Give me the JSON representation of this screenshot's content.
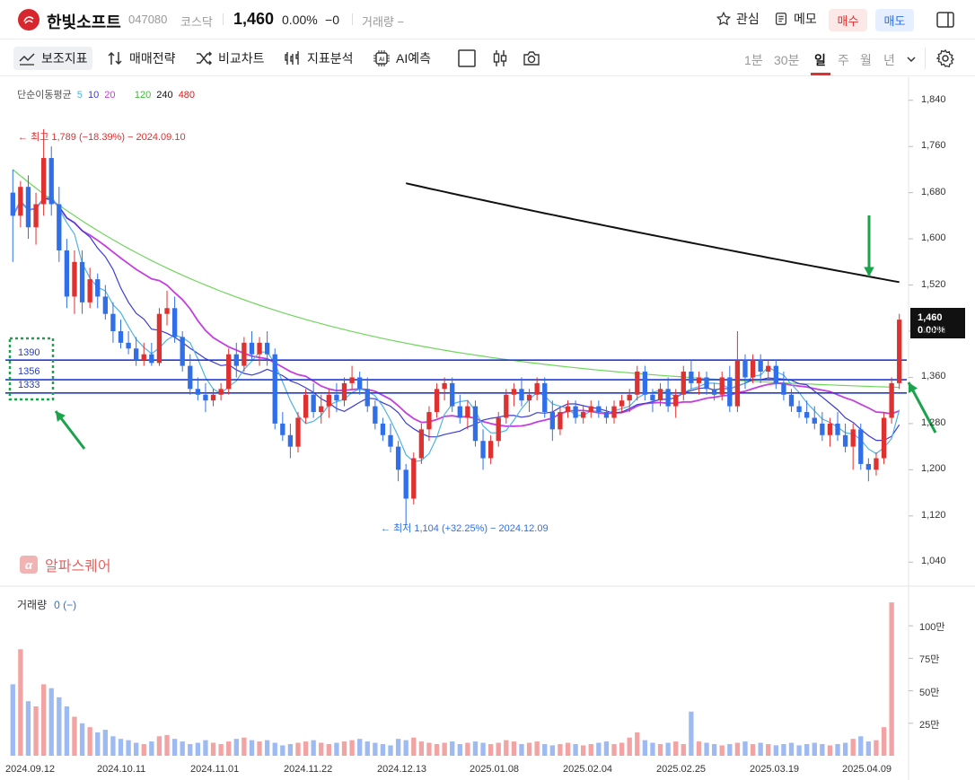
{
  "header": {
    "stock_name": "한빛소프트",
    "stock_code": "047080",
    "market": "코스닥",
    "price": "1,460",
    "change_pct": "0.00%",
    "change_abs": "0",
    "change_abs_symbol": "−",
    "volume_label": "거래량 −",
    "favorite_label": "관심",
    "memo_label": "메모",
    "buy_label": "매수",
    "sell_label": "매도"
  },
  "toolbar": {
    "indicator_label": "보조지표",
    "strategy_label": "매매전략",
    "compare_label": "비교차트",
    "analysis_label": "지표분석",
    "ai_label": "AI예측",
    "periods": [
      "1분",
      "30분",
      "일",
      "주",
      "월",
      "년"
    ],
    "active_period": "일"
  },
  "colors": {
    "up": "#e03131",
    "down": "#2f6fea",
    "ma5": "#4fb3e6",
    "ma10": "#3b3bd6",
    "ma20": "#c43ee0",
    "ma120": "#6fd65c",
    "ma240": "#111111",
    "ma480": "#d81b1b",
    "support_line": "#1f3bd9",
    "annotation_arrow": "#1aa34a",
    "box_border": "#1aa34a"
  },
  "chart_data": {
    "type": "candlestick",
    "title": "",
    "legend_title": "단순이동평균",
    "legend_items": [
      "5",
      "10",
      "20",
      "120",
      "240",
      "480"
    ],
    "y_axis_ticks": [
      "1,840",
      "1,760",
      "1,680",
      "1,600",
      "1,520",
      "1,440",
      "1,360",
      "1,280",
      "1,200",
      "1,120",
      "1,040"
    ],
    "y_min": 1000,
    "y_max": 1880,
    "x_date_labels": [
      "2024.09.12",
      "2024.10.11",
      "2024.11.01",
      "2024.11.22",
      "2024.12.13",
      "2025.01.08",
      "2025.02.04",
      "2025.02.25",
      "2025.03.19",
      "2025.04.09"
    ],
    "last_price_tag": "1,460",
    "last_change_tag": "0.00%",
    "high_annotation": "최고 1,789 (−18.39%) − 2024.09.10",
    "low_annotation": "최저 1,104 (+32.25%) − 2024.12.09",
    "support_lines": [
      1390,
      1356,
      1333
    ],
    "support_labels": [
      "1390",
      "1356",
      "1333"
    ],
    "candles": [
      [
        1680,
        1720,
        1560,
        1640
      ],
      [
        1640,
        1700,
        1620,
        1690
      ],
      [
        1690,
        1710,
        1600,
        1620
      ],
      [
        1620,
        1680,
        1590,
        1660
      ],
      [
        1660,
        1790,
        1640,
        1740
      ],
      [
        1740,
        1760,
        1640,
        1660
      ],
      [
        1660,
        1690,
        1560,
        1580
      ],
      [
        1580,
        1600,
        1480,
        1500
      ],
      [
        1500,
        1580,
        1470,
        1560
      ],
      [
        1560,
        1580,
        1470,
        1490
      ],
      [
        1490,
        1550,
        1480,
        1530
      ],
      [
        1530,
        1540,
        1480,
        1500
      ],
      [
        1500,
        1520,
        1460,
        1470
      ],
      [
        1470,
        1490,
        1420,
        1440
      ],
      [
        1440,
        1460,
        1410,
        1420
      ],
      [
        1420,
        1440,
        1400,
        1410
      ],
      [
        1410,
        1430,
        1380,
        1390
      ],
      [
        1390,
        1420,
        1380,
        1400
      ],
      [
        1400,
        1420,
        1380,
        1385
      ],
      [
        1385,
        1480,
        1380,
        1470
      ],
      [
        1470,
        1510,
        1450,
        1480
      ],
      [
        1480,
        1500,
        1420,
        1430
      ],
      [
        1430,
        1440,
        1370,
        1380
      ],
      [
        1380,
        1400,
        1330,
        1340
      ],
      [
        1340,
        1360,
        1320,
        1330
      ],
      [
        1330,
        1350,
        1300,
        1320
      ],
      [
        1320,
        1340,
        1310,
        1330
      ],
      [
        1330,
        1350,
        1320,
        1340
      ],
      [
        1340,
        1410,
        1330,
        1400
      ],
      [
        1400,
        1420,
        1360,
        1380
      ],
      [
        1380,
        1430,
        1370,
        1420
      ],
      [
        1420,
        1440,
        1390,
        1400
      ],
      [
        1400,
        1430,
        1380,
        1420
      ],
      [
        1420,
        1440,
        1380,
        1400
      ],
      [
        1400,
        1410,
        1270,
        1280
      ],
      [
        1280,
        1300,
        1250,
        1260
      ],
      [
        1260,
        1280,
        1220,
        1240
      ],
      [
        1240,
        1300,
        1230,
        1290
      ],
      [
        1290,
        1340,
        1280,
        1330
      ],
      [
        1330,
        1350,
        1290,
        1300
      ],
      [
        1300,
        1330,
        1280,
        1310
      ],
      [
        1310,
        1340,
        1290,
        1330
      ],
      [
        1330,
        1350,
        1300,
        1320
      ],
      [
        1320,
        1360,
        1310,
        1350
      ],
      [
        1350,
        1380,
        1340,
        1360
      ],
      [
        1360,
        1370,
        1330,
        1340
      ],
      [
        1340,
        1360,
        1300,
        1310
      ],
      [
        1310,
        1320,
        1270,
        1280
      ],
      [
        1280,
        1290,
        1250,
        1260
      ],
      [
        1260,
        1280,
        1230,
        1240
      ],
      [
        1240,
        1250,
        1180,
        1200
      ],
      [
        1200,
        1210,
        1104,
        1150
      ],
      [
        1150,
        1230,
        1140,
        1220
      ],
      [
        1220,
        1280,
        1210,
        1270
      ],
      [
        1270,
        1310,
        1250,
        1300
      ],
      [
        1300,
        1350,
        1290,
        1340
      ],
      [
        1340,
        1360,
        1320,
        1350
      ],
      [
        1350,
        1360,
        1300,
        1310
      ],
      [
        1310,
        1330,
        1280,
        1290
      ],
      [
        1290,
        1320,
        1270,
        1310
      ],
      [
        1310,
        1320,
        1240,
        1250
      ],
      [
        1250,
        1270,
        1200,
        1220
      ],
      [
        1220,
        1260,
        1210,
        1250
      ],
      [
        1250,
        1300,
        1240,
        1290
      ],
      [
        1290,
        1340,
        1280,
        1330
      ],
      [
        1330,
        1350,
        1310,
        1340
      ],
      [
        1340,
        1360,
        1310,
        1320
      ],
      [
        1320,
        1340,
        1300,
        1330
      ],
      [
        1330,
        1360,
        1320,
        1350
      ],
      [
        1350,
        1360,
        1290,
        1300
      ],
      [
        1300,
        1320,
        1250,
        1270
      ],
      [
        1270,
        1310,
        1260,
        1300
      ],
      [
        1300,
        1320,
        1290,
        1310
      ],
      [
        1310,
        1320,
        1280,
        1290
      ],
      [
        1290,
        1310,
        1280,
        1300
      ],
      [
        1300,
        1320,
        1290,
        1310
      ],
      [
        1310,
        1320,
        1290,
        1300
      ],
      [
        1300,
        1310,
        1280,
        1290
      ],
      [
        1290,
        1320,
        1280,
        1310
      ],
      [
        1310,
        1330,
        1300,
        1320
      ],
      [
        1320,
        1340,
        1300,
        1330
      ],
      [
        1330,
        1380,
        1320,
        1370
      ],
      [
        1370,
        1380,
        1320,
        1330
      ],
      [
        1330,
        1340,
        1300,
        1320
      ],
      [
        1320,
        1350,
        1310,
        1340
      ],
      [
        1340,
        1360,
        1300,
        1310
      ],
      [
        1310,
        1340,
        1290,
        1330
      ],
      [
        1330,
        1380,
        1320,
        1370
      ],
      [
        1370,
        1390,
        1340,
        1350
      ],
      [
        1350,
        1370,
        1330,
        1360
      ],
      [
        1360,
        1370,
        1330,
        1340
      ],
      [
        1340,
        1350,
        1320,
        1330
      ],
      [
        1330,
        1370,
        1320,
        1360
      ],
      [
        1360,
        1380,
        1300,
        1310
      ],
      [
        1310,
        1440,
        1300,
        1390
      ],
      [
        1390,
        1400,
        1340,
        1360
      ],
      [
        1360,
        1400,
        1350,
        1390
      ],
      [
        1390,
        1400,
        1350,
        1370
      ],
      [
        1370,
        1390,
        1360,
        1380
      ],
      [
        1380,
        1390,
        1340,
        1350
      ],
      [
        1350,
        1370,
        1320,
        1330
      ],
      [
        1330,
        1340,
        1300,
        1310
      ],
      [
        1310,
        1320,
        1290,
        1300
      ],
      [
        1300,
        1320,
        1280,
        1290
      ],
      [
        1290,
        1310,
        1270,
        1280
      ],
      [
        1280,
        1300,
        1250,
        1260
      ],
      [
        1260,
        1290,
        1240,
        1280
      ],
      [
        1280,
        1300,
        1250,
        1260
      ],
      [
        1260,
        1280,
        1230,
        1240
      ],
      [
        1240,
        1280,
        1200,
        1270
      ],
      [
        1270,
        1280,
        1200,
        1210
      ],
      [
        1210,
        1220,
        1180,
        1200
      ],
      [
        1200,
        1230,
        1190,
        1220
      ],
      [
        1220,
        1300,
        1210,
        1290
      ],
      [
        1290,
        1360,
        1280,
        1350
      ],
      [
        1350,
        1470,
        1340,
        1460
      ]
    ],
    "volumes": [
      55,
      82,
      42,
      38,
      55,
      52,
      45,
      38,
      30,
      25,
      22,
      18,
      20,
      15,
      13,
      12,
      10,
      9,
      11,
      15,
      16,
      13,
      11,
      9,
      10,
      12,
      10,
      9,
      11,
      13,
      14,
      12,
      11,
      12,
      10,
      8,
      9,
      10,
      11,
      12,
      10,
      9,
      10,
      11,
      12,
      13,
      11,
      10,
      9,
      8,
      13,
      12,
      14,
      11,
      10,
      9,
      10,
      11,
      9,
      10,
      11,
      10,
      9,
      10,
      12,
      11,
      9,
      10,
      11,
      9,
      8,
      9,
      10,
      9,
      8,
      9,
      10,
      11,
      9,
      10,
      14,
      18,
      12,
      10,
      9,
      10,
      11,
      9,
      34,
      11,
      10,
      9,
      8,
      9,
      10,
      11,
      9,
      10,
      9,
      8,
      9,
      10,
      8,
      9,
      10,
      9,
      8,
      9,
      10,
      13,
      15,
      11,
      12,
      22,
      118
    ],
    "volume_ticks": [
      "100만",
      "75만",
      "50만",
      "25만"
    ],
    "volume_legend_title": "거래량",
    "volume_legend_value": "0 (−)"
  },
  "watermark_text": "알파스퀘어"
}
